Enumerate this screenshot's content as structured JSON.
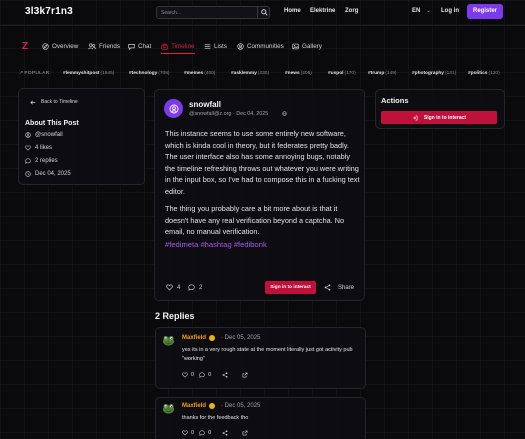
{
  "header": {
    "brand": "3l3k7r1n3",
    "search_placeholder": "Search...",
    "nav": [
      "Home",
      "Elektrine",
      "Zorg"
    ],
    "language": "EN",
    "login": "Log in",
    "register": "Register"
  },
  "secondary_nav": {
    "logo": "Z",
    "items": [
      {
        "label": "Overview",
        "icon": "compass-icon"
      },
      {
        "label": "Friends",
        "icon": "people-icon"
      },
      {
        "label": "Chat",
        "icon": "chat-icon"
      },
      {
        "label": "Timeline",
        "icon": "timeline-icon",
        "active": true
      },
      {
        "label": "Lists",
        "icon": "list-icon"
      },
      {
        "label": "Communities",
        "icon": "community-icon"
      },
      {
        "label": "Gallery",
        "icon": "gallery-icon"
      }
    ]
  },
  "popular": {
    "label": "POPULAR:",
    "tags": [
      {
        "name": "#lemmyshitpost",
        "count": "(1645)"
      },
      {
        "name": "#technology",
        "count": "(708)"
      },
      {
        "name": "#memes",
        "count": "(400)"
      },
      {
        "name": "#asklemmy",
        "count": "(330)"
      },
      {
        "name": "#news",
        "count": "(206)"
      },
      {
        "name": "#uspol",
        "count": "(170)"
      },
      {
        "name": "#trump",
        "count": "(149)"
      },
      {
        "name": "#photography",
        "count": "(121)"
      },
      {
        "name": "#politics",
        "count": "(120)"
      }
    ]
  },
  "sidebar": {
    "back": "Back to Timeline",
    "about_title": "About This Post",
    "author": "@snowfall",
    "likes": "4 likes",
    "replies": "2 replies",
    "date": "Dec 04, 2025"
  },
  "post": {
    "author": "snowfall",
    "meta": "@snowfall@z.org · Dec 04, 2025",
    "paragraphs": [
      "This instance seems to use some entirely new software, which is kinda cool in theory, but it federates pretty badly. The user interface also has some annoying bugs, notably the timeline refreshing throws out whatever you were writing in the input box, so I've had to compose this in a fucking text editor.",
      "The thing you probably care a bit more about is that it doesn't have any real verification beyond a captcha. No email, no manual verification."
    ],
    "hashtags": "#fedimeta #hashtag #fedibonk",
    "like_count": "4",
    "reply_count": "2",
    "interact": "Sign in to interact",
    "share": "Share"
  },
  "actions": {
    "title": "Actions",
    "interact": "Sign in to interact"
  },
  "replies": {
    "title": "2 Replies",
    "items": [
      {
        "author": "Maxfield",
        "date": "· Dec 05, 2025",
        "text": "yes its in a very rough state at the moment literally just got activity pub \"working\"",
        "likes": "0",
        "comments": "0"
      },
      {
        "author": "Maxfield",
        "date": "· Dec 05, 2025",
        "text": "thanks for the feedback tho",
        "likes": "0",
        "comments": "0"
      }
    ]
  },
  "colors": {
    "accent_red": "#e11d48",
    "register_purple": "#7c3aed",
    "hashtag_purple": "#a855f7",
    "reply_author": "#f59e0b"
  }
}
